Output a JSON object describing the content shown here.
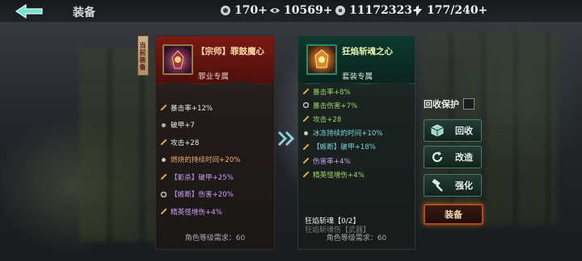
{
  "header": {
    "title": "装备",
    "resources": [
      {
        "icon": "power-icon",
        "value": "170+"
      },
      {
        "icon": "spirit-icon",
        "value": "10569+"
      },
      {
        "icon": "coin-icon",
        "value": "11172323+"
      },
      {
        "icon": "stamina-bolt-icon",
        "value": "177/240+"
      }
    ]
  },
  "current_tag": "当前装备",
  "current_item": {
    "name": "【宗师】罪鼓魔心",
    "type": "罪业专属",
    "stats": [
      {
        "text": "暴击率+12%",
        "color": "white",
        "icon": "sword-stat-icon"
      },
      {
        "text": "破甲+7",
        "color": "white",
        "icon": "armor-break-stat-icon"
      },
      {
        "text": "攻击+28",
        "color": "white",
        "icon": "attack-stat-icon"
      },
      {
        "text": "燃烧的持续时间+20%",
        "color": "orange",
        "icon": "fire-stat-icon"
      },
      {
        "text": "【影杀】破甲+25%",
        "color": "purple",
        "icon": "shadow-stat-icon"
      },
      {
        "text": "【嫉断】伤害+20%",
        "color": "purple",
        "icon": "skill-stat-icon"
      },
      {
        "text": "精英怪增伤+4%",
        "color": "purple",
        "icon": "elite-stat-icon"
      }
    ],
    "requirement": "角色等级需求：60"
  },
  "new_item": {
    "name": "狂焰斩魂之心",
    "type": "套装专属",
    "stats": [
      {
        "text": "暴击率+8%",
        "color": "green",
        "icon": "sword-stat-icon"
      },
      {
        "text": "暴击伤害+7%",
        "color": "green",
        "icon": "crit-damage-stat-icon"
      },
      {
        "text": "攻击+28",
        "color": "green",
        "icon": "attack-stat-icon"
      },
      {
        "text": "冰冻持续的时间+10%",
        "color": "cyan",
        "icon": "ice-stat-icon"
      },
      {
        "text": "【嫉断】破甲+18%",
        "color": "cyan",
        "icon": "skill-stat-icon"
      },
      {
        "text": "伤害率+4%",
        "color": "purple",
        "icon": "damage-stat-icon"
      },
      {
        "text": "精英怪增伤+4%",
        "color": "green",
        "icon": "elite-stat-icon"
      }
    ],
    "set_title": "狂焰斩魂【0/2】",
    "set_subtitle": "狂焰斩魂伤【武器】",
    "requirement": "角色等级需求：60"
  },
  "actions": {
    "recycle_protect": "回收保护",
    "recycle": "回收",
    "reforge": "改造",
    "enhance": "强化",
    "equip": "装备"
  },
  "colors": {
    "white": "#e8e8e8",
    "orange": "#f0a868",
    "purple": "#c9a0f0",
    "green": "#9ad46a",
    "cyan": "#7ad4d8",
    "equip_glow": "#d2641e"
  }
}
